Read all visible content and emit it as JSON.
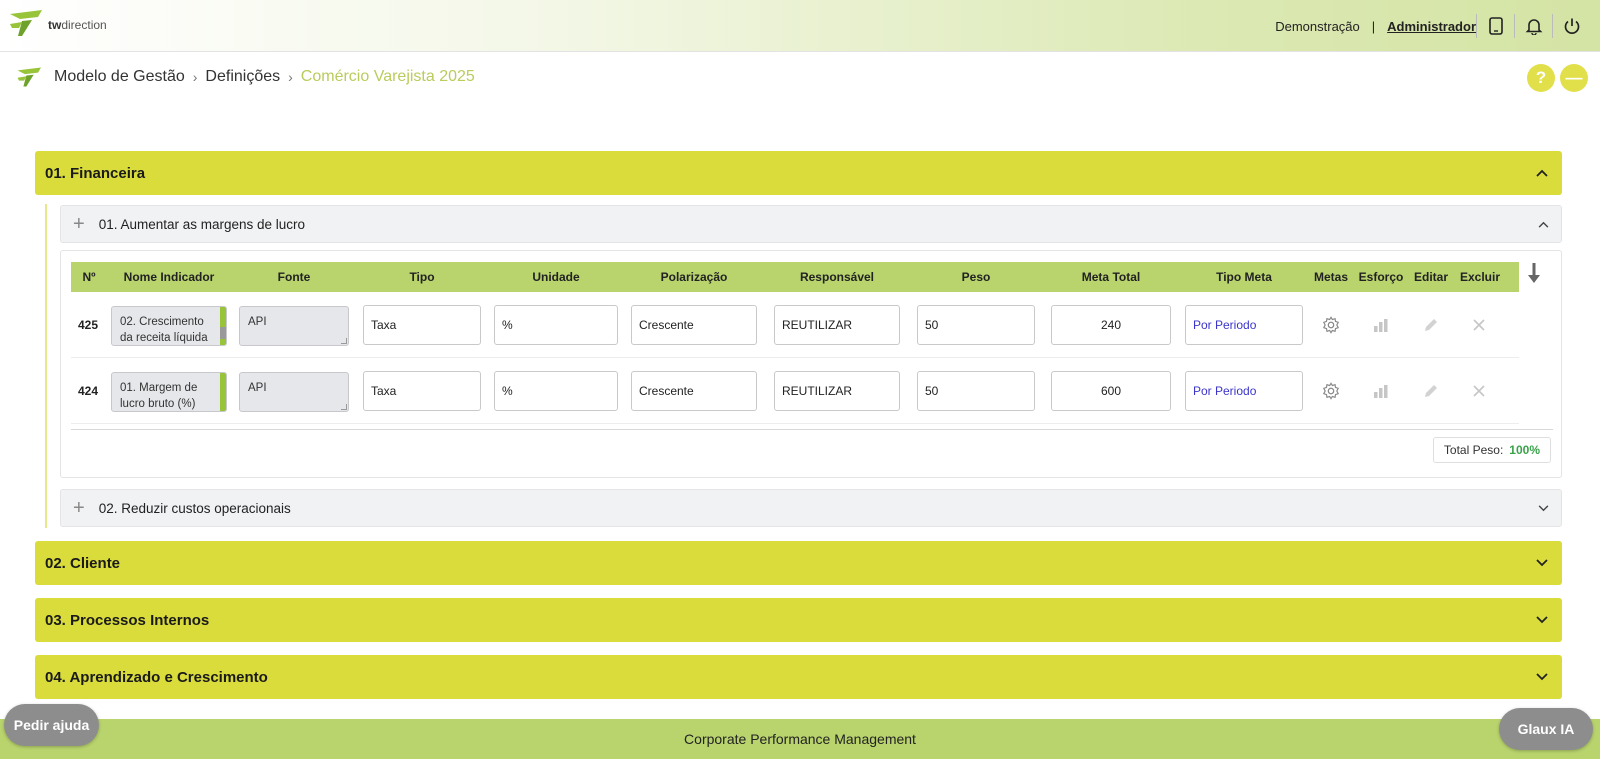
{
  "brand": {
    "logo_text_bold": "tw",
    "logo_text": "direction"
  },
  "header": {
    "demo_label": "Demonstração",
    "separator": "|",
    "admin_label": "Administrador",
    "icons": [
      "tablet-icon",
      "bell-icon",
      "power-icon"
    ]
  },
  "breadcrumb": {
    "items": [
      "Modelo de Gestão",
      "Definições",
      "Comércio Varejista 2025"
    ],
    "help_symbol": "?",
    "collapse_symbol": "—"
  },
  "sections": [
    {
      "title": "01. Financeira",
      "expanded": true
    },
    {
      "title": "02. Cliente",
      "expanded": false
    },
    {
      "title": "03. Processos Internos",
      "expanded": false
    },
    {
      "title": "04. Aprendizado e Crescimento",
      "expanded": false
    }
  ],
  "objectives": [
    {
      "title": "01. Aumentar as margens de lucro",
      "expanded": true
    },
    {
      "title": "02. Reduzir custos operacionais",
      "expanded": false
    }
  ],
  "table": {
    "headers": [
      "Nº",
      "Nome Indicador",
      "Fonte",
      "Tipo",
      "Unidade",
      "Polarização",
      "Responsável",
      "Peso",
      "Meta Total",
      "Tipo Meta",
      "Metas",
      "Esforço",
      "Editar",
      "Excluir"
    ],
    "rows": [
      {
        "num": "425",
        "name": "02. Crescimento da receita líquida",
        "source": "API",
        "tipo": "Taxa",
        "unidade": "%",
        "polarizacao": "Crescente",
        "responsavel": "REUTILIZAR",
        "peso": "50",
        "meta_total": "240",
        "tipo_meta": "Por Periodo"
      },
      {
        "num": "424",
        "name": "01. Margem de lucro bruto (%)",
        "source": "API",
        "tipo": "Taxa",
        "unidade": "%",
        "polarizacao": "Crescente",
        "responsavel": "REUTILIZAR",
        "peso": "50",
        "meta_total": "600",
        "tipo_meta": "Por Periodo"
      }
    ],
    "total_label": "Total Peso:",
    "total_value": "100%"
  },
  "footer": {
    "text": "Corporate Performance Management"
  },
  "help_button": "Pedir ajuda",
  "ai_button": "Glaux IA",
  "colors": {
    "section": "#d9dc3b",
    "table_header": "#b9d46d",
    "accent": "#b9cc5c",
    "total_ok": "#3aa34a",
    "tipo_meta_text": "#3b35c9"
  }
}
